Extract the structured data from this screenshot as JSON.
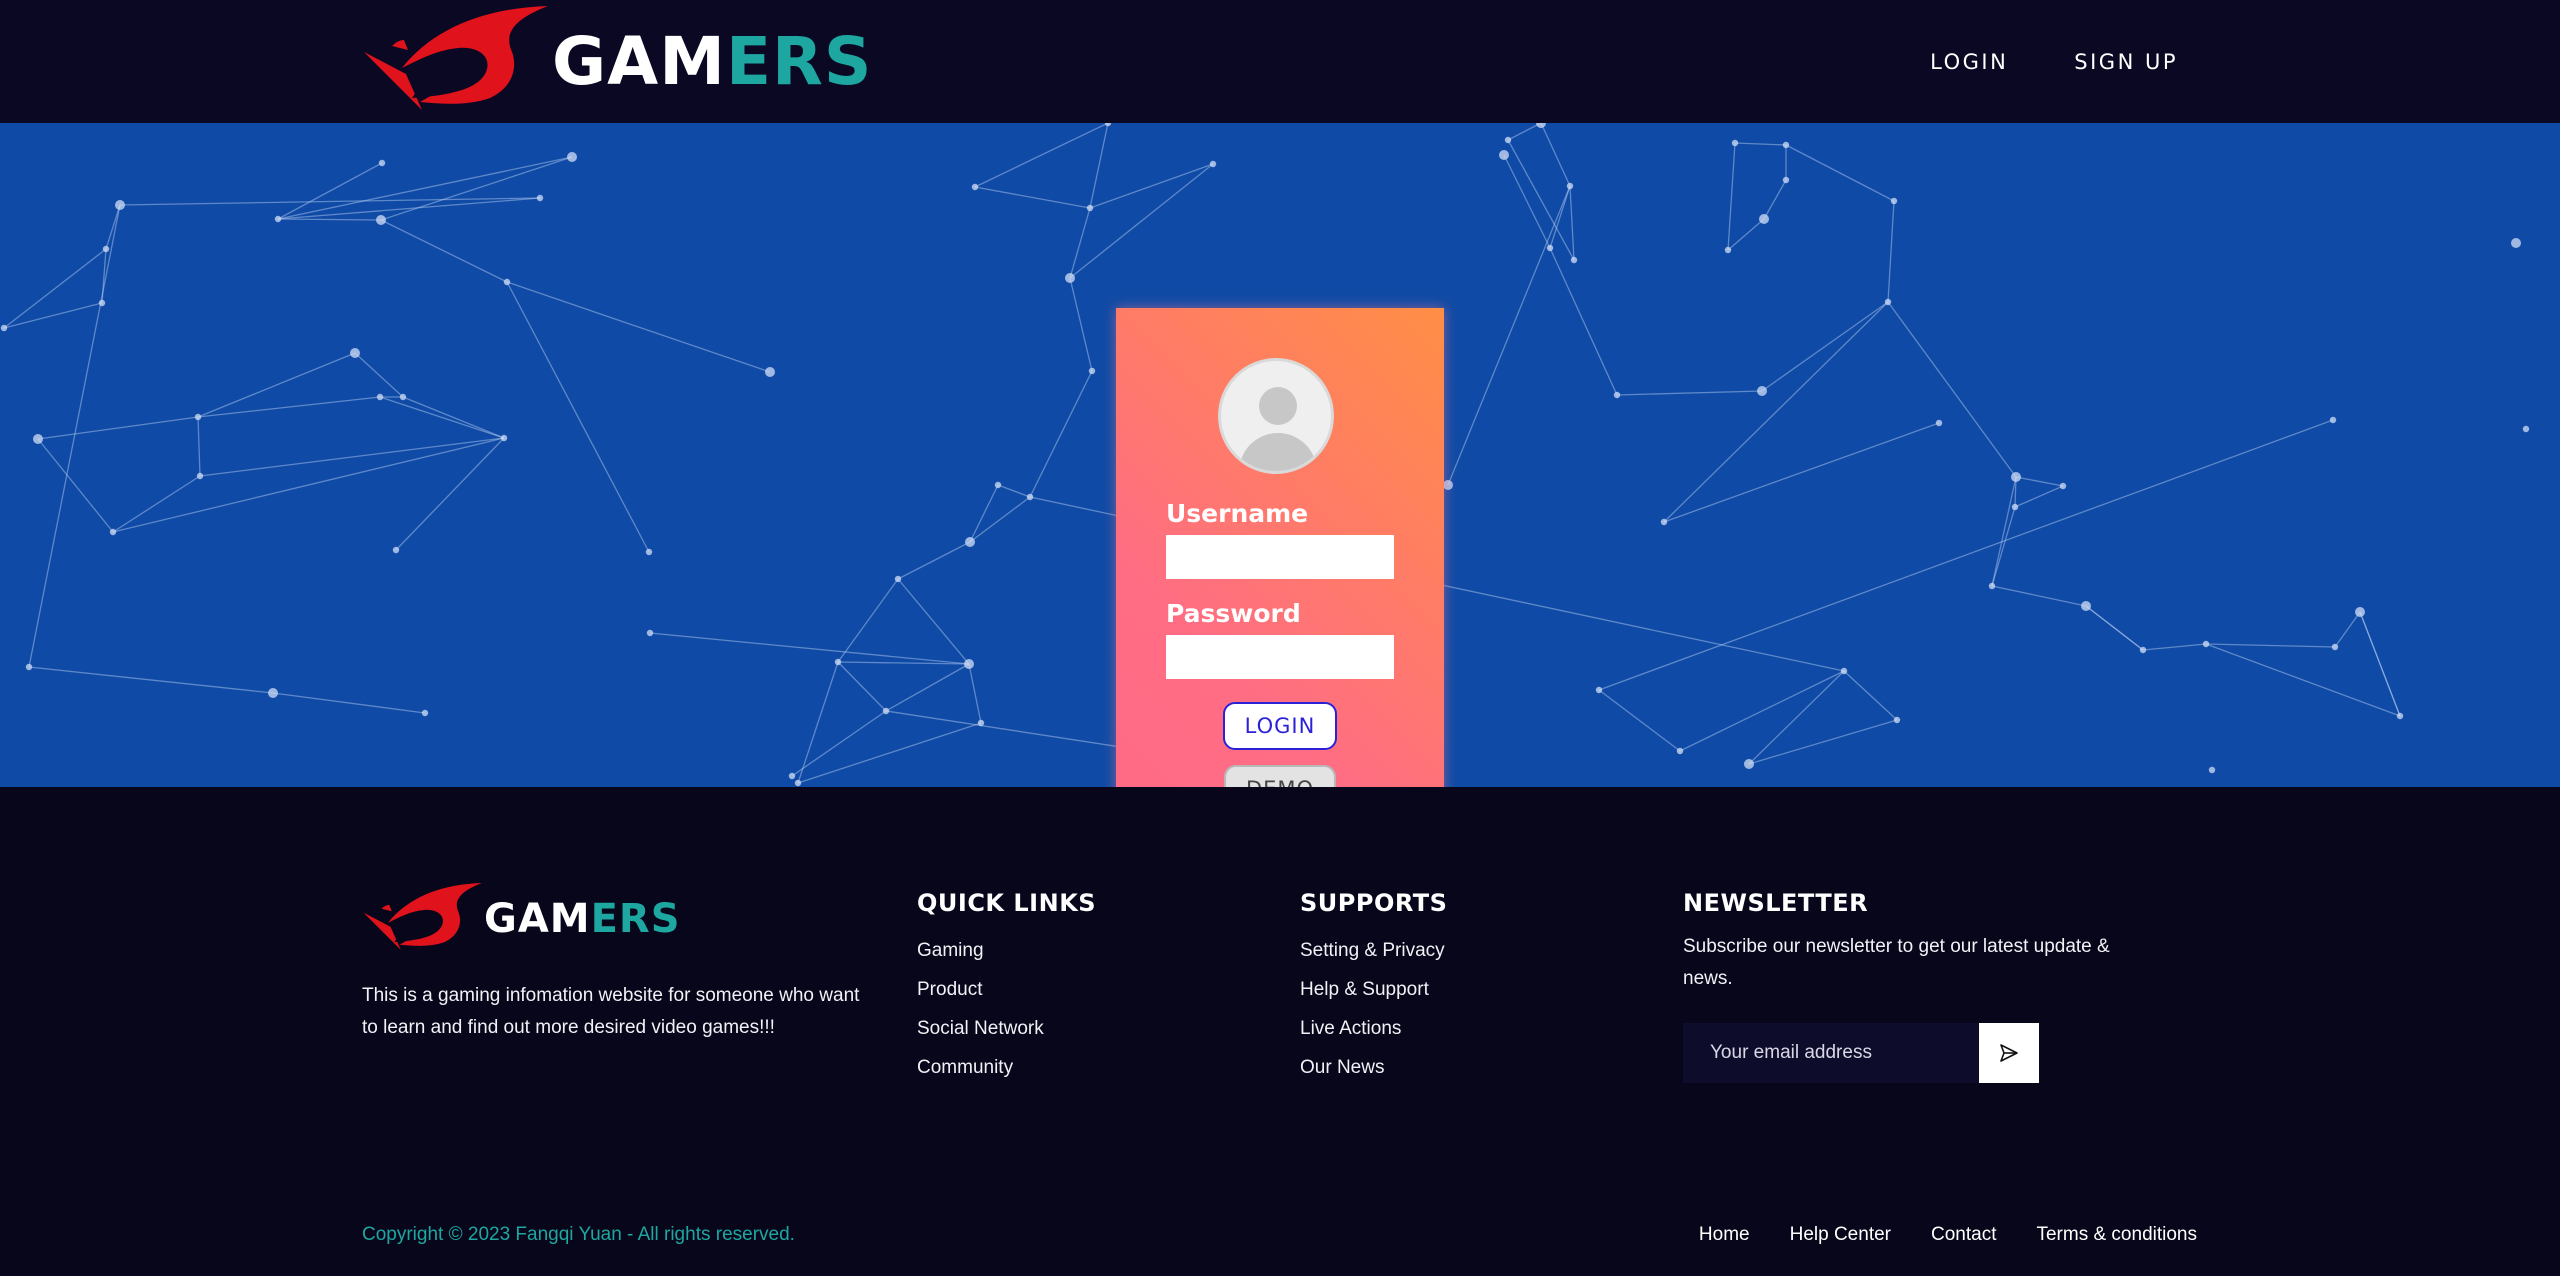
{
  "brand": {
    "name_part1": "GAM",
    "name_part2": "ERS",
    "logo_icon": "rog-eye-icon",
    "color_primary_text": "#ffffff",
    "color_accent": "#1ea7a1",
    "color_logo_red": "#e0121b"
  },
  "header": {
    "nav": [
      {
        "label": "LOGIN"
      },
      {
        "label": "SIGN UP"
      }
    ],
    "background": "#0a0823"
  },
  "hero": {
    "background": "#0f4ba6"
  },
  "login_form": {
    "avatar_icon": "user-avatar-icon",
    "username_label": "Username",
    "username_value": "",
    "password_label": "Password",
    "password_value": "",
    "login_button": "LOGIN",
    "demo_button": "DEMO",
    "card_gradient": [
      "#ff8e45",
      "#ff6a86"
    ]
  },
  "footer": {
    "description": "This is a gaming infomation website for someone who want to learn and find out more desired video games!!!",
    "quick_links": {
      "title": "QUICK LINKS",
      "items": [
        "Gaming",
        "Product",
        "Social Network",
        "Community"
      ]
    },
    "supports": {
      "title": "SUPPORTS",
      "items": [
        "Setting & Privacy",
        "Help & Support",
        "Live Actions",
        "Our News"
      ]
    },
    "newsletter": {
      "title": "NEWSLETTER",
      "text": "Subscribe our newsletter to get our latest update & news.",
      "email_placeholder": "Your email address",
      "email_value": "",
      "send_icon": "send-arrow-icon"
    },
    "copyright": "Copyright © 2023 Fangqi Yuan - All rights reserved.",
    "bottom_links": [
      "Home",
      "Help Center",
      "Contact",
      "Terms & conditions"
    ]
  }
}
